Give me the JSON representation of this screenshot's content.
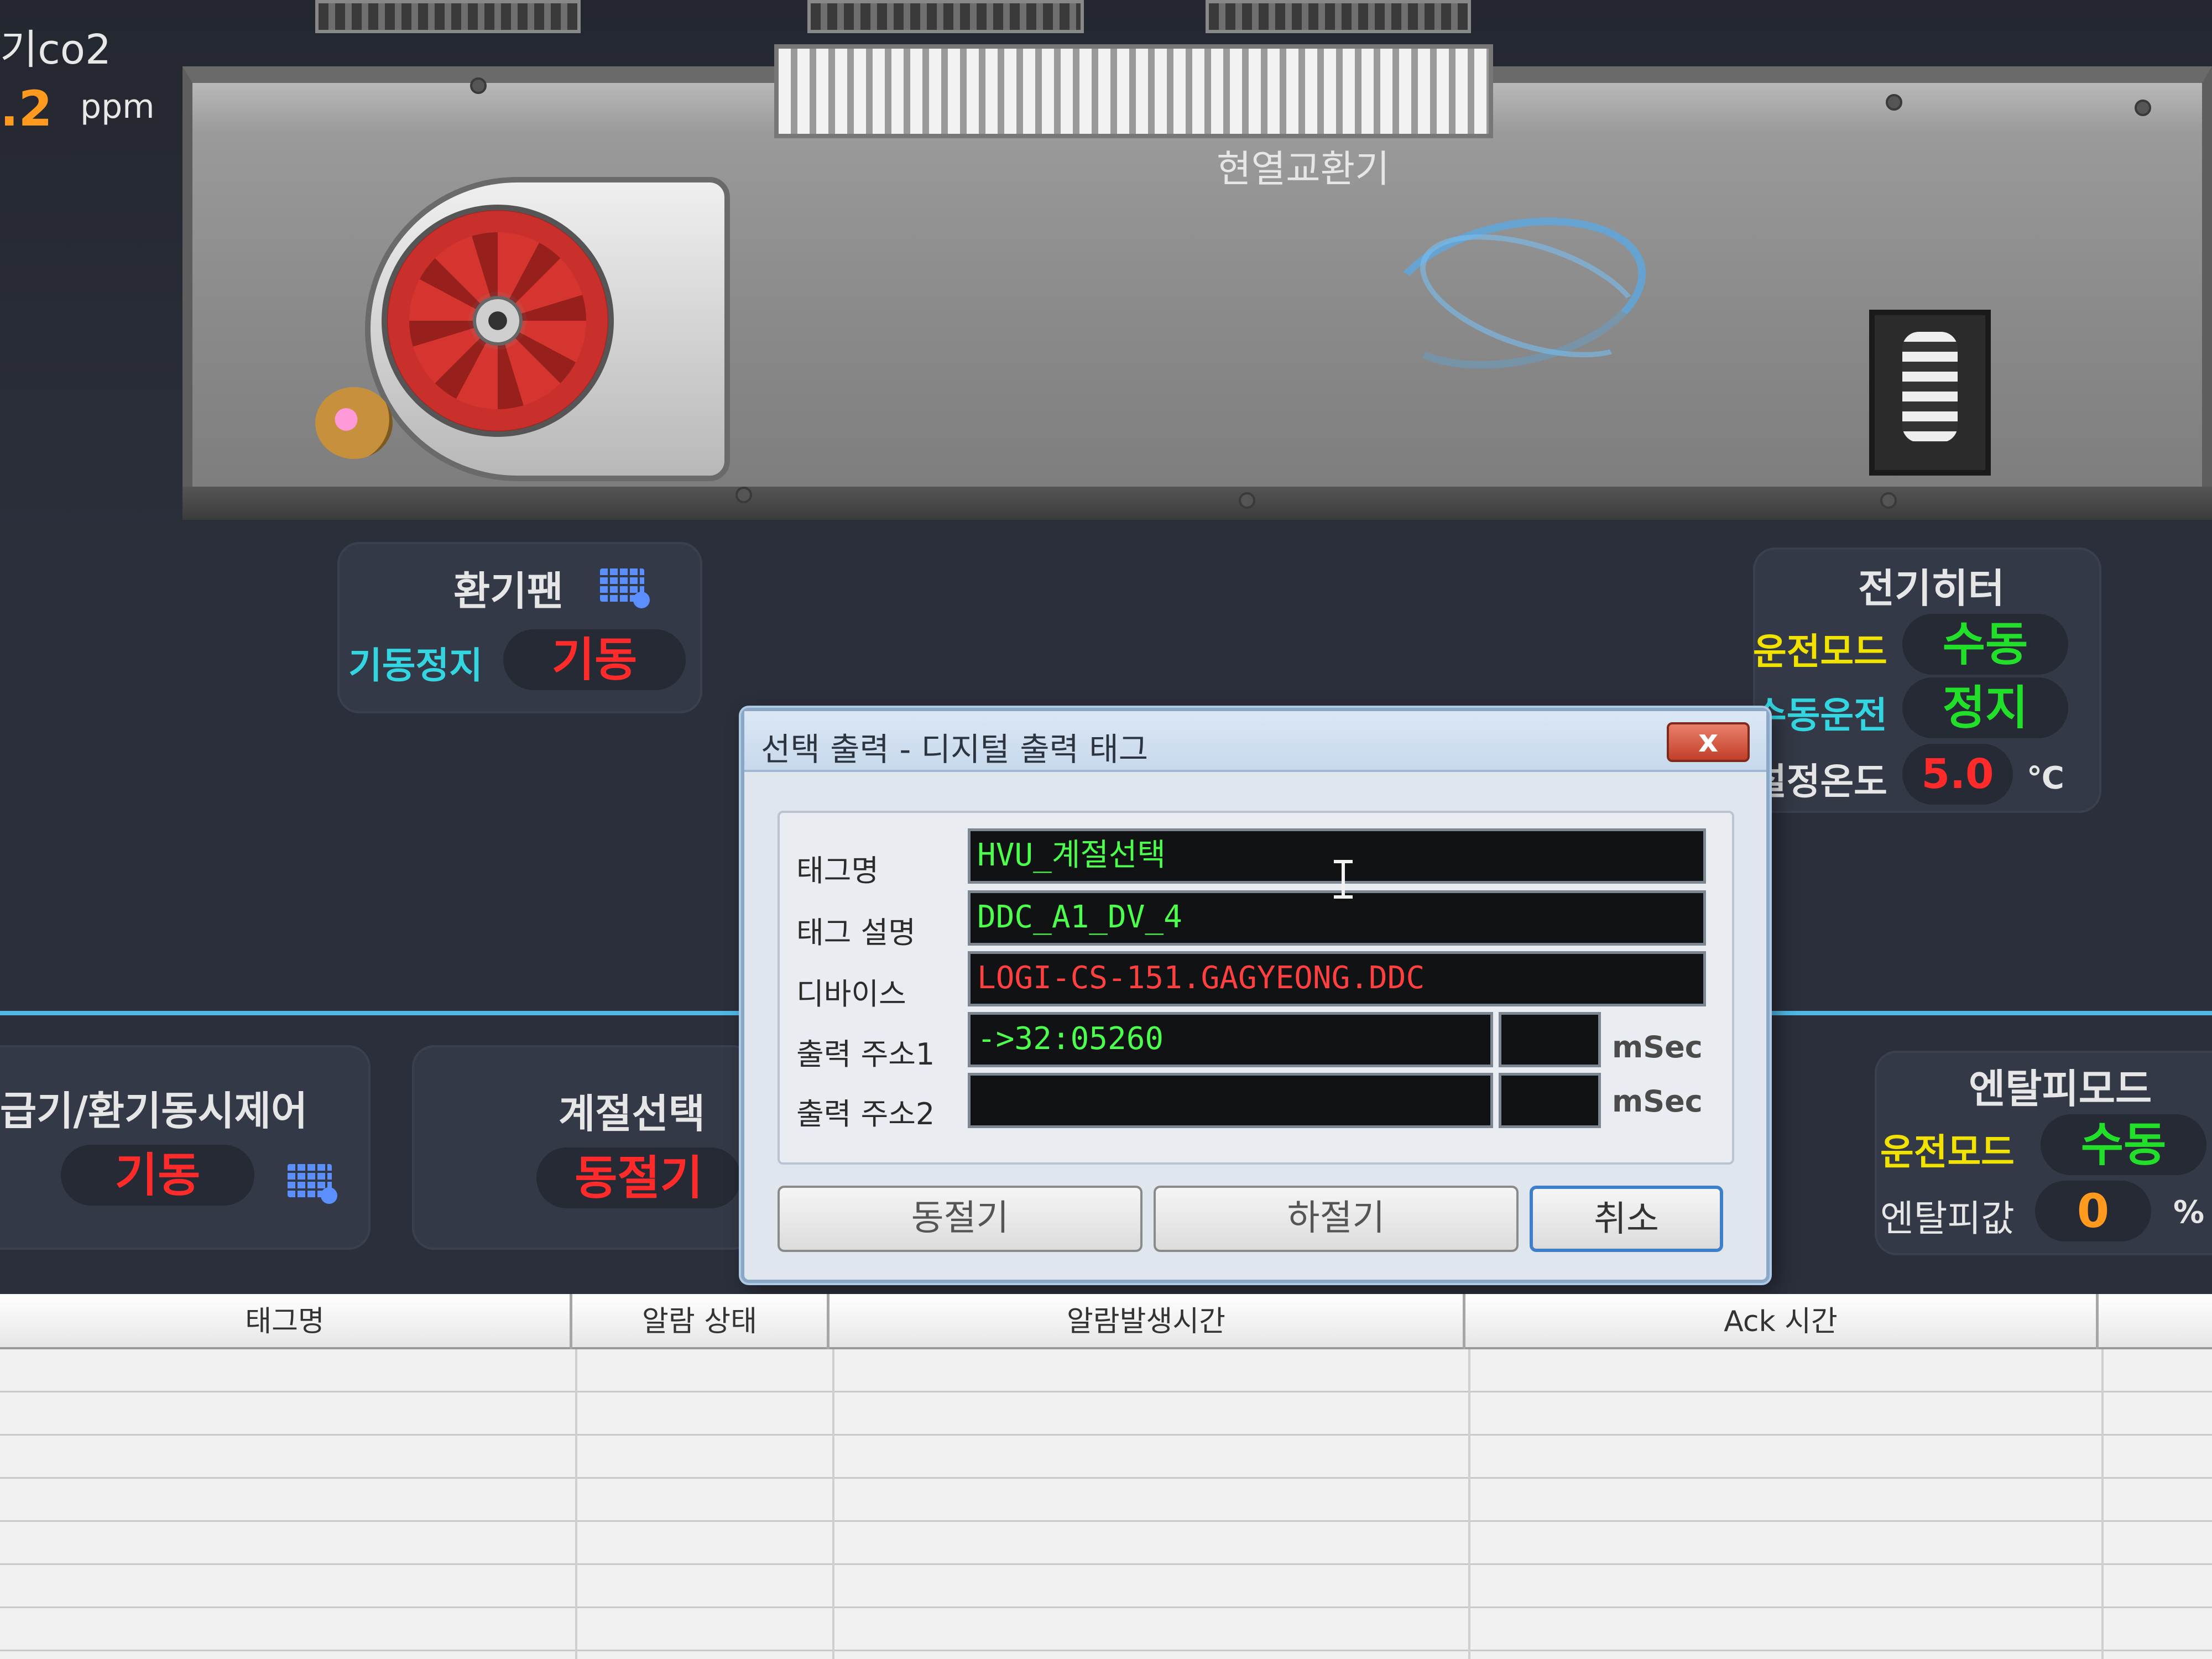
{
  "equipment": {
    "co2_label": "기co2",
    "co2_value": ".2",
    "co2_unit": "ppm",
    "heat_exchanger_label": "현열교환기"
  },
  "exhaust_fan": {
    "title": "환기팬",
    "label": "기동정지",
    "value": "기동"
  },
  "electric_heater": {
    "title": "전기히터",
    "mode_label": "운전모드",
    "mode_value": "수동",
    "manual_label": "수동운전",
    "manual_value": "정지",
    "setpoint_label": "설정온도",
    "setpoint_value": "5.0",
    "setpoint_unit": "℃"
  },
  "supply_exhaust_control": {
    "title": "급기/환기동시제어",
    "value": "기동"
  },
  "season_select": {
    "title": "계절선택",
    "value": "동절기"
  },
  "enthalpy_mode": {
    "title": "엔탈피모드",
    "mode_label": "운전모드",
    "mode_value": "수동",
    "value_label": "엔탈피값",
    "value": "0",
    "unit": "%"
  },
  "dialog": {
    "title": "선택 출력 - 디지털 출력 태그",
    "close_label": "x",
    "fields": {
      "tag_name_label": "태그명",
      "tag_name_value": "HVU_계절선택",
      "tag_desc_label": "태그 설명",
      "tag_desc_value": "DDC_A1_DV_4",
      "device_label": "디바이스",
      "device_value": "LOGI-CS-151.GAGYEONG.DDC",
      "addr1_label": "출력 주소1",
      "addr1_value": "->32:05260",
      "addr1_msec": "",
      "addr1_unit": "mSec",
      "addr2_label": "출력 주소2",
      "addr2_value": "",
      "addr2_msec": "",
      "addr2_unit": "mSec"
    },
    "buttons": {
      "winter": "동절기",
      "summer": "하절기",
      "cancel": "취소"
    }
  },
  "alarm_table": {
    "headers": [
      "태그명",
      "알람 상태",
      "알람발생시간",
      "Ack 시간"
    ]
  },
  "colors": {
    "background": "#2b2f3c",
    "cyan_label": "#33d6e0",
    "yellow_label": "#f2e200",
    "active_red": "#ff2a2a",
    "manual_green": "#22e02a",
    "value_orange": "#ff9a1e",
    "dialog_bg": "#dfe6ee"
  }
}
